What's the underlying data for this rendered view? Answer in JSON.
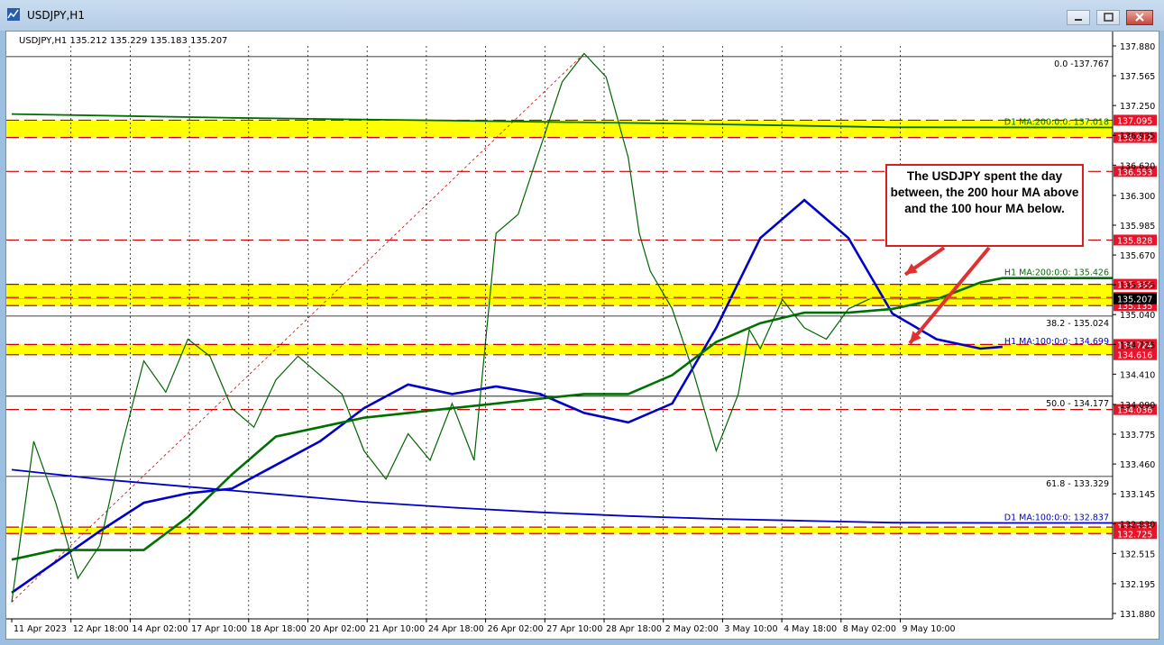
{
  "window": {
    "title": "USDJPY,H1",
    "minimize_icon": "minimize-icon",
    "maximize_icon": "maximize-icon",
    "close_icon": "close-icon"
  },
  "chart_data": {
    "type": "line",
    "title": "USDJPY,H1  135.212 135.229 135.183 135.207",
    "ohlc_header": {
      "symbol": "USDJPY,H1",
      "open": 135.212,
      "high": 135.229,
      "low": 135.183,
      "close": 135.207
    },
    "ylim": [
      131.88,
      137.88
    ],
    "y_ticks": [
      137.88,
      137.565,
      137.25,
      136.935,
      136.62,
      136.3,
      135.985,
      135.67,
      135.355,
      135.04,
      134.725,
      134.41,
      134.09,
      133.775,
      133.46,
      133.145,
      132.83,
      132.515,
      132.195,
      131.88
    ],
    "x_ticks": [
      "11 Apr 2023",
      "12 Apr 18:00",
      "14 Apr 02:00",
      "17 Apr 10:00",
      "18 Apr 18:00",
      "20 Apr 02:00",
      "21 Apr 10:00",
      "24 Apr 18:00",
      "26 Apr 02:00",
      "27 Apr 10:00",
      "28 Apr 18:00",
      "2 May 02:00",
      "3 May 10:00",
      "4 May 18:00",
      "8 May 02:00",
      "9 May 10:00"
    ],
    "grid": false,
    "colors": {
      "price": "#006400",
      "ma100": "#0000c8",
      "ma200": "#007000",
      "price_line": "#000000",
      "fib": "#000000",
      "level": "#cc0000",
      "zone": "#ffff00",
      "label_bg": "#e8142a"
    },
    "series": [
      {
        "name": "H1 MA:100:0:0",
        "label": "H1 MA:100:0:0: 134.699",
        "color": "#0000c8",
        "x": [
          0,
          8,
          12,
          16,
          20,
          24,
          28,
          32,
          36,
          40,
          44,
          48,
          52,
          56,
          60,
          64,
          68,
          72,
          76,
          80,
          84,
          88,
          90
        ],
        "values": [
          132.1,
          132.75,
          133.05,
          133.15,
          133.2,
          133.45,
          133.7,
          134.05,
          134.3,
          134.2,
          134.28,
          134.2,
          134.0,
          133.9,
          134.1,
          134.9,
          135.85,
          136.25,
          135.85,
          135.05,
          134.78,
          134.68,
          134.7
        ]
      },
      {
        "name": "H1 MA:200:0:0",
        "label": "H1 MA:200:0:0: 135.426",
        "color": "#007000",
        "x": [
          0,
          4,
          8,
          12,
          16,
          20,
          24,
          28,
          32,
          36,
          40,
          44,
          48,
          52,
          56,
          60,
          64,
          68,
          72,
          76,
          80,
          84,
          88,
          90,
          100
        ],
        "values": [
          132.45,
          132.55,
          132.55,
          132.55,
          132.9,
          133.35,
          133.75,
          133.85,
          133.95,
          134.0,
          134.05,
          134.1,
          134.15,
          134.2,
          134.2,
          134.4,
          134.75,
          134.95,
          135.06,
          135.06,
          135.1,
          135.2,
          135.38,
          135.426,
          135.426
        ]
      },
      {
        "name": "D1 MA:200:0:0",
        "label": "D1 MA:200:0:0: 137.018",
        "color": "#007000",
        "x": [
          0,
          20,
          40,
          60,
          80,
          100
        ],
        "values": [
          137.16,
          137.12,
          137.09,
          137.06,
          137.02,
          137.018
        ]
      },
      {
        "name": "D1 MA:100:0:0",
        "label": "D1 MA:100:0:0: 132.837",
        "color": "#0000c8",
        "x": [
          0,
          8,
          16,
          24,
          32,
          40,
          48,
          56,
          64,
          72,
          80,
          90,
          100
        ],
        "values": [
          133.4,
          133.3,
          133.22,
          133.14,
          133.06,
          133.0,
          132.95,
          132.91,
          132.88,
          132.86,
          132.84,
          132.837,
          132.837
        ]
      }
    ],
    "price": {
      "x": [
        0,
        2,
        4,
        6,
        8,
        10,
        12,
        14,
        16,
        18,
        20,
        22,
        24,
        26,
        28,
        30,
        32,
        34,
        36,
        38,
        40,
        42,
        44,
        46,
        48,
        50,
        52,
        54,
        56,
        57,
        58,
        60,
        62,
        64,
        66,
        67,
        68,
        70,
        72,
        74,
        76,
        78,
        80,
        82,
        84,
        86,
        88,
        90
      ],
      "values": [
        132.0,
        133.7,
        133.05,
        132.25,
        132.6,
        133.65,
        134.55,
        134.22,
        134.78,
        134.6,
        134.05,
        133.85,
        134.35,
        134.6,
        134.4,
        134.2,
        133.6,
        133.3,
        133.78,
        133.5,
        134.1,
        133.5,
        135.9,
        136.1,
        136.8,
        137.5,
        137.8,
        137.55,
        136.7,
        135.9,
        135.5,
        135.1,
        134.4,
        133.6,
        134.2,
        134.88,
        134.68,
        135.2,
        134.9,
        134.78,
        135.1,
        135.21,
        135.207,
        135.207,
        135.207,
        135.207,
        135.207,
        135.207
      ]
    },
    "current_price": 135.207,
    "annotations": {
      "callout": "The USDJPY spent the day between, the 200 hour MA above and the 100 hour MA below.",
      "fib_labels": [
        "0.0 -137.767",
        "38.2 - 135.024",
        "50.0 - 134.177",
        "61.8 - 133.329"
      ],
      "level_labels": [
        "137.095",
        "136.912",
        "136.553",
        "135.828",
        "135.360",
        "135.221",
        "135.135",
        "134.724",
        "134.616",
        "134.036",
        "132.793",
        "132.725"
      ],
      "price_label": "135.207"
    },
    "levels": [
      137.095,
      136.912,
      136.553,
      135.828,
      135.36,
      135.221,
      135.135,
      134.724,
      134.616,
      134.036,
      132.793,
      132.725
    ],
    "zones": [
      [
        136.912,
        137.095
      ],
      [
        135.135,
        135.36
      ],
      [
        134.616,
        134.724
      ],
      [
        132.725,
        132.793
      ]
    ]
  }
}
